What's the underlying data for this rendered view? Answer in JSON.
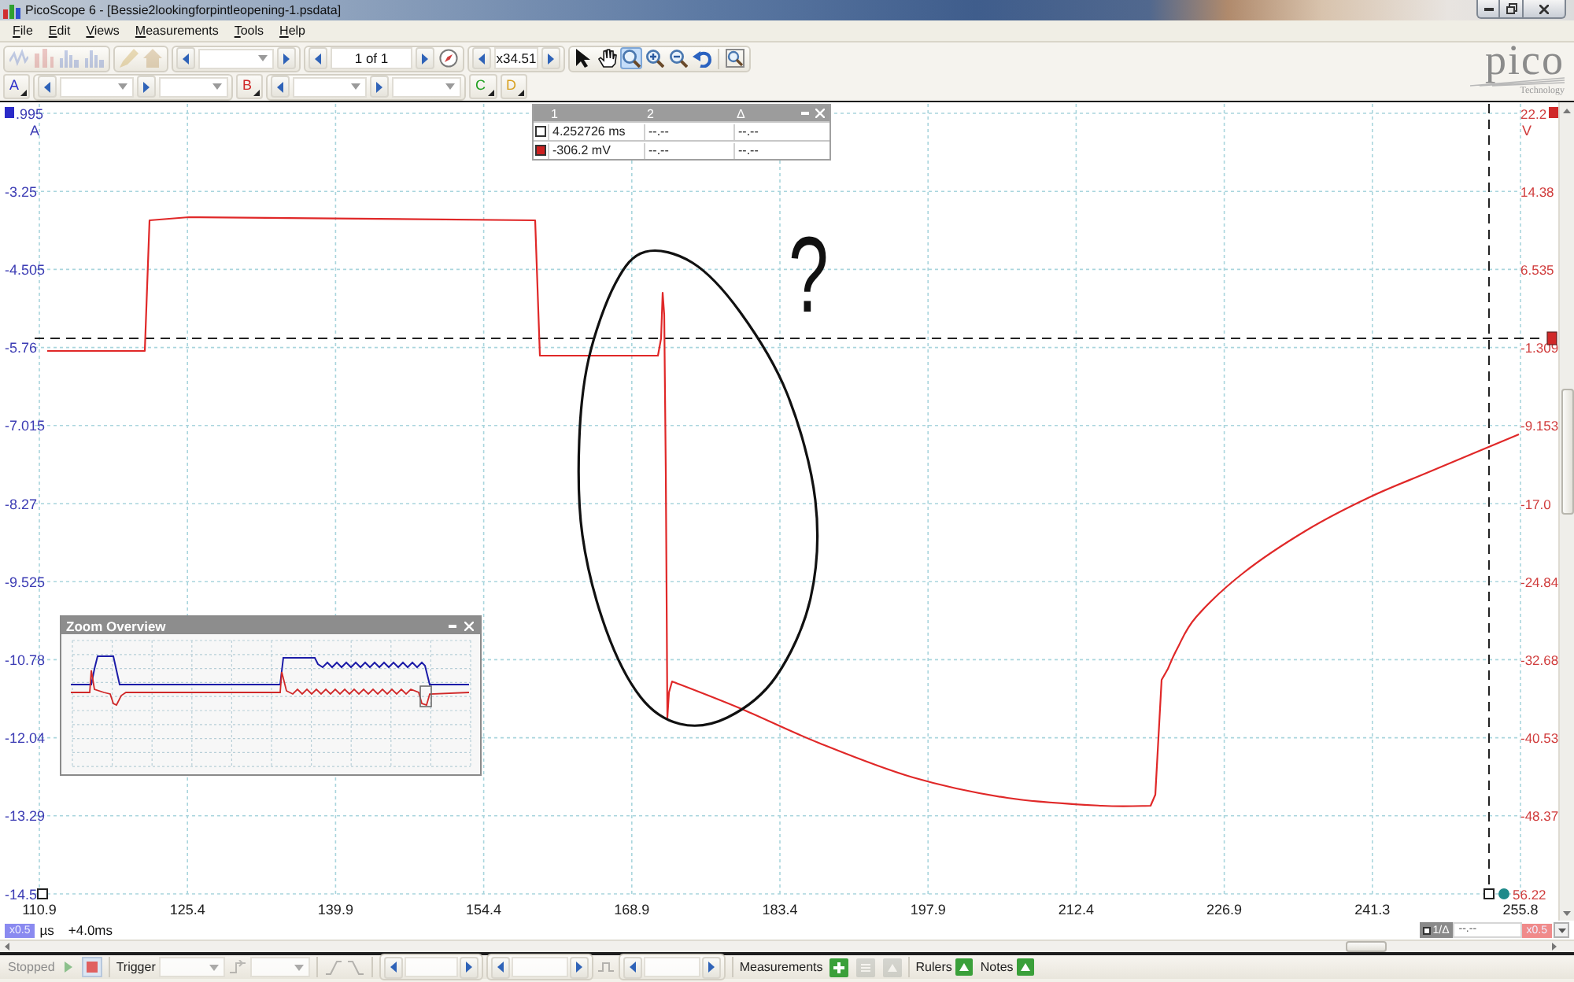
{
  "window": {
    "title": "PicoScope 6 - [Bessie2lookingforpintleopening-1.psdata]"
  },
  "menu": [
    "File",
    "Edit",
    "Views",
    "Measurements",
    "Tools",
    "Help"
  ],
  "toolbar": {
    "view_tools": [
      {
        "kind": "scope",
        "disabled": true
      },
      {
        "kind": "persistence",
        "disabled": true
      },
      {
        "kind": "spectrum",
        "disabled": true
      },
      {
        "kind": "spectrum",
        "disabled": true
      },
      {
        "kind": "pen",
        "disabled": true
      },
      {
        "kind": "home",
        "disabled": true
      }
    ],
    "buffer": {
      "value": "1 of 1"
    },
    "zoom": {
      "value": "x34.51"
    },
    "tools": [
      {
        "kind": "pointer",
        "selected": false
      },
      {
        "kind": "hand",
        "selected": false
      },
      {
        "kind": "zoom",
        "selected": true
      },
      {
        "kind": "zoom_in",
        "selected": false
      },
      {
        "kind": "zoom_out",
        "selected": false
      },
      {
        "kind": "undo",
        "selected": false
      },
      {
        "kind": "fit",
        "selected": false
      }
    ]
  },
  "channels": [
    {
      "label": "A",
      "color": "#2b2bc8",
      "enabled": true
    },
    {
      "label": "B",
      "color": "#d02828",
      "enabled": true
    },
    {
      "label": "C",
      "color": "#20a020",
      "enabled": false
    },
    {
      "label": "D",
      "color": "#d8a020",
      "enabled": false
    }
  ],
  "logo": {
    "name": "pico",
    "tagline": "Technology"
  },
  "plot": {
    "left_axis": {
      "unit": "A",
      "labels": [
        ".995",
        "-3.25",
        "-4.505",
        "-5.76",
        "-7.015",
        "-8.27",
        "-9.525",
        "-10.78",
        "-12.04",
        "-13.29",
        "-14.5"
      ]
    },
    "right_axis": {
      "unit": "V",
      "labels": [
        "22.2",
        "14.38",
        "6.535",
        "-1.309",
        "-9.153",
        "-17.0",
        "-24.84",
        "-32.68",
        "-40.53",
        "-48.37",
        "56.22"
      ]
    },
    "x_axis": {
      "labels": [
        "110.9",
        "125.4",
        "139.9",
        "154.4",
        "168.9",
        "183.4",
        "197.9",
        "212.4",
        "226.9",
        "241.3",
        "255.8"
      ]
    },
    "annotation": {
      "text": "?"
    },
    "ruler_table": {
      "columns": [
        "1",
        "2",
        "Δ"
      ],
      "rows": [
        {
          "color": "#ffffff",
          "cells": [
            "4.252726 ms",
            "--.--",
            "--.--"
          ]
        },
        {
          "color": "#cc2020",
          "cells": [
            "-306.2 mV",
            "--.--",
            "--.--"
          ]
        }
      ]
    },
    "zoom_overview": {
      "title": "Zoom Overview"
    }
  },
  "axis_bar": {
    "zoom": "x0.5",
    "unit": "µs",
    "offset": "+4.0ms",
    "ruler_mode": "1/Δ",
    "ruler_value": "--.--",
    "right_zoom": "x0.5"
  },
  "status_bar": {
    "state": "Stopped",
    "run_buttons": [
      {
        "kind": "start",
        "selected": false
      },
      {
        "kind": "stop",
        "selected": true
      }
    ],
    "trigger": "Trigger",
    "measurements": {
      "label": "Measurements",
      "buttons": [
        {
          "kind": "add",
          "disabled": false
        },
        {
          "kind": "edit",
          "disabled": true
        },
        {
          "kind": "delete",
          "disabled": true
        }
      ]
    },
    "rulers": "Rulers",
    "notes": "Notes"
  }
}
